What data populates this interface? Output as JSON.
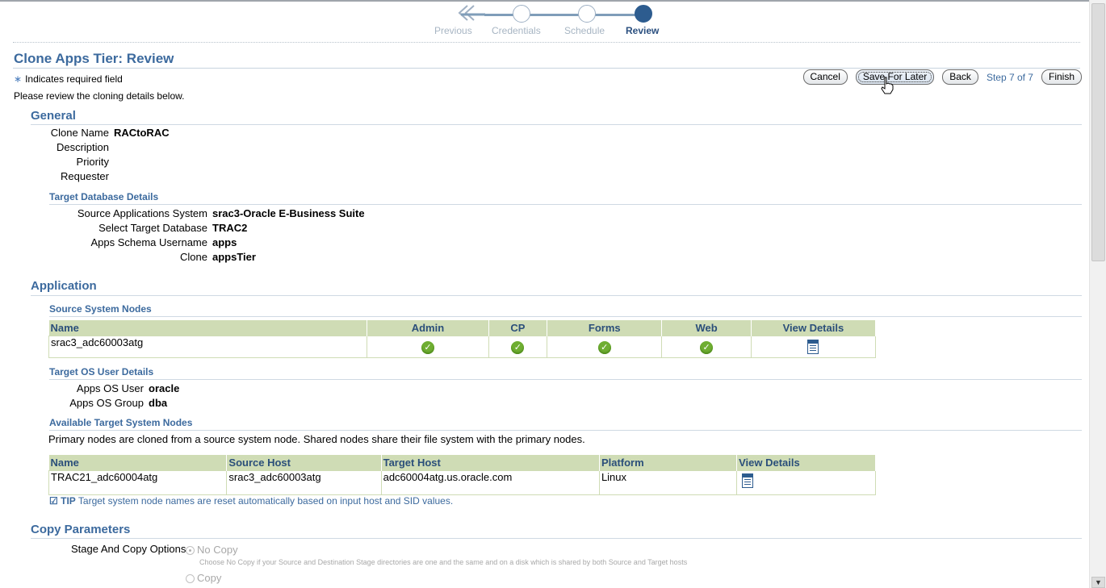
{
  "train": {
    "steps": [
      "Previous",
      "Credentials",
      "Schedule",
      "Review"
    ],
    "active": "Review"
  },
  "page": {
    "title": "Clone Apps Tier: Review",
    "required_note": "Indicates required field",
    "intro": "Please review the cloning details below."
  },
  "buttons": {
    "cancel": "Cancel",
    "save_for_later": "Save For Later",
    "back": "Back",
    "step": "Step 7 of 7",
    "finish": "Finish"
  },
  "general": {
    "heading": "General",
    "fields": [
      {
        "label": "Clone Name",
        "value": "RACtoRAC"
      },
      {
        "label": "Description",
        "value": ""
      },
      {
        "label": "Priority",
        "value": ""
      },
      {
        "label": "Requester",
        "value": ""
      }
    ],
    "target_db": {
      "heading": "Target Database Details",
      "fields": [
        {
          "label": "Source Applications System",
          "value": "srac3-Oracle E-Business Suite"
        },
        {
          "label": "Select Target Database",
          "value": "TRAC2"
        },
        {
          "label": "Apps Schema Username",
          "value": "apps"
        },
        {
          "label": "Clone",
          "value": "appsTier"
        }
      ]
    }
  },
  "application": {
    "heading": "Application",
    "source_nodes": {
      "heading": "Source System Nodes",
      "columns": [
        "Name",
        "Admin",
        "CP",
        "Forms",
        "Web",
        "View Details"
      ],
      "rows": [
        {
          "name": "srac3_adc60003atg",
          "admin": true,
          "cp": true,
          "forms": true,
          "web": true
        }
      ]
    },
    "os_user": {
      "heading": "Target OS User Details",
      "fields": [
        {
          "label": "Apps OS User",
          "value": "oracle"
        },
        {
          "label": "Apps OS Group",
          "value": "dba"
        }
      ]
    },
    "target_nodes": {
      "heading": "Available Target System Nodes",
      "description": "Primary nodes are cloned from a source system node. Shared nodes share their file system with the primary nodes.",
      "columns": [
        "Name",
        "Source Host",
        "Target Host",
        "Platform",
        "View Details"
      ],
      "rows": [
        {
          "name": "TRAC21_adc60004atg",
          "source_host": "srac3_adc60003atg",
          "target_host": "adc60004atg.us.oracle.com",
          "platform": "Linux"
        }
      ]
    },
    "tip_label": "TIP",
    "tip_text": "Target system node names are reset automatically based on input host and SID values."
  },
  "copy_parameters": {
    "heading": "Copy Parameters",
    "label": "Stage And Copy Options",
    "options": [
      {
        "label": "No Copy",
        "selected": true,
        "help": "Choose No Copy if your Source and Destination Stage directories are one and the same and on a disk which is shared by both Source and Target hosts"
      },
      {
        "label": "Copy",
        "selected": false
      }
    ]
  },
  "colors": {
    "accent": "#3c6a9e",
    "table_header": "#cfdcb5",
    "check": "#6fae32"
  }
}
